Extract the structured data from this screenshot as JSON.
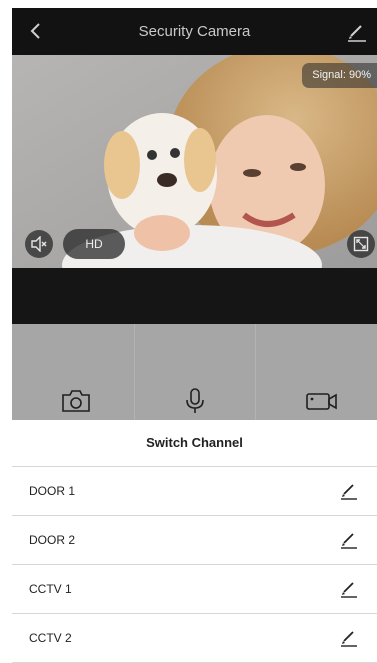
{
  "header": {
    "title": "Security Camera",
    "back_icon": "chevron-left-icon",
    "edit_icon": "pencil-icon"
  },
  "video": {
    "signal_text": "Signal: 90%",
    "hd_label": "HD",
    "mute_icon": "speaker-muted-icon",
    "fullscreen_icon": "fullscreen-icon"
  },
  "controls": [
    {
      "icon": "camera-icon"
    },
    {
      "icon": "microphone-icon"
    },
    {
      "icon": "video-record-icon"
    }
  ],
  "channel_sheet": {
    "title": "Switch Channel",
    "channels": [
      {
        "name": "DOOR 1"
      },
      {
        "name": "DOOR 2"
      },
      {
        "name": "CCTV 1"
      },
      {
        "name": "CCTV 2"
      }
    ]
  },
  "colors": {
    "header_bg": "#121212",
    "controls_bg": "#a6a6a6",
    "sheet_bg": "#ffffff"
  }
}
